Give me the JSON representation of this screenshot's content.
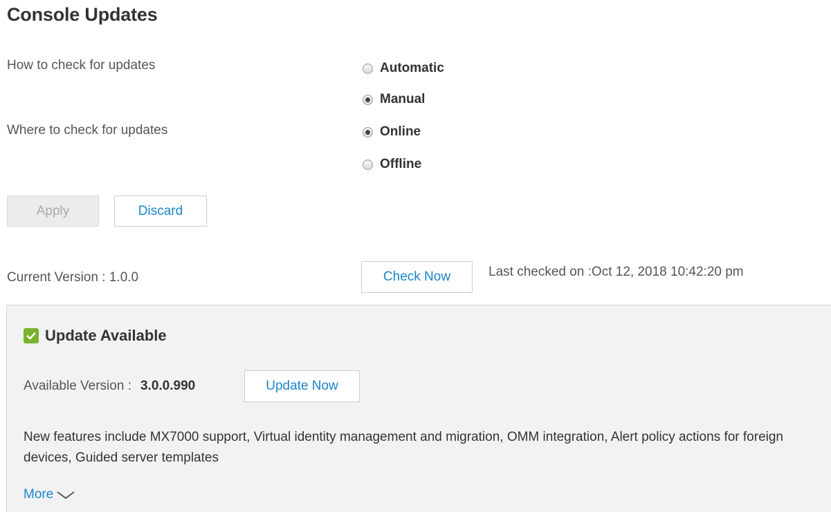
{
  "page": {
    "title": "Console Updates"
  },
  "how_to_check": {
    "label": "How to check for updates",
    "options": [
      {
        "label": "Automatic",
        "checked": false
      },
      {
        "label": "Manual",
        "checked": true
      }
    ]
  },
  "where_to_check": {
    "label": "Where to check for updates",
    "options": [
      {
        "label": "Online",
        "checked": true
      },
      {
        "label": "Offline",
        "checked": false
      }
    ]
  },
  "actions": {
    "apply_label": "Apply",
    "discard_label": "Discard"
  },
  "version": {
    "current_text": "Current Version : 1.0.0",
    "check_now_label": "Check Now",
    "last_checked_text": "Last checked on :Oct 12, 2018 10:42:20 pm"
  },
  "update": {
    "heading": "Update Available",
    "status_icon": "checkbox-checked-icon",
    "available_label": "Available Version :",
    "available_version": "3.0.0.990",
    "update_now_label": "Update Now",
    "description": "New features include MX7000 support, Virtual identity management and migration, OMM integration, Alert policy actions for foreign devices, Guided server templates",
    "more_label": "More",
    "more_icon": "chevron-down-icon"
  },
  "colors": {
    "accent": "#1a86c8",
    "success": "#78b22e",
    "panel_bg": "#f2f2f2"
  }
}
